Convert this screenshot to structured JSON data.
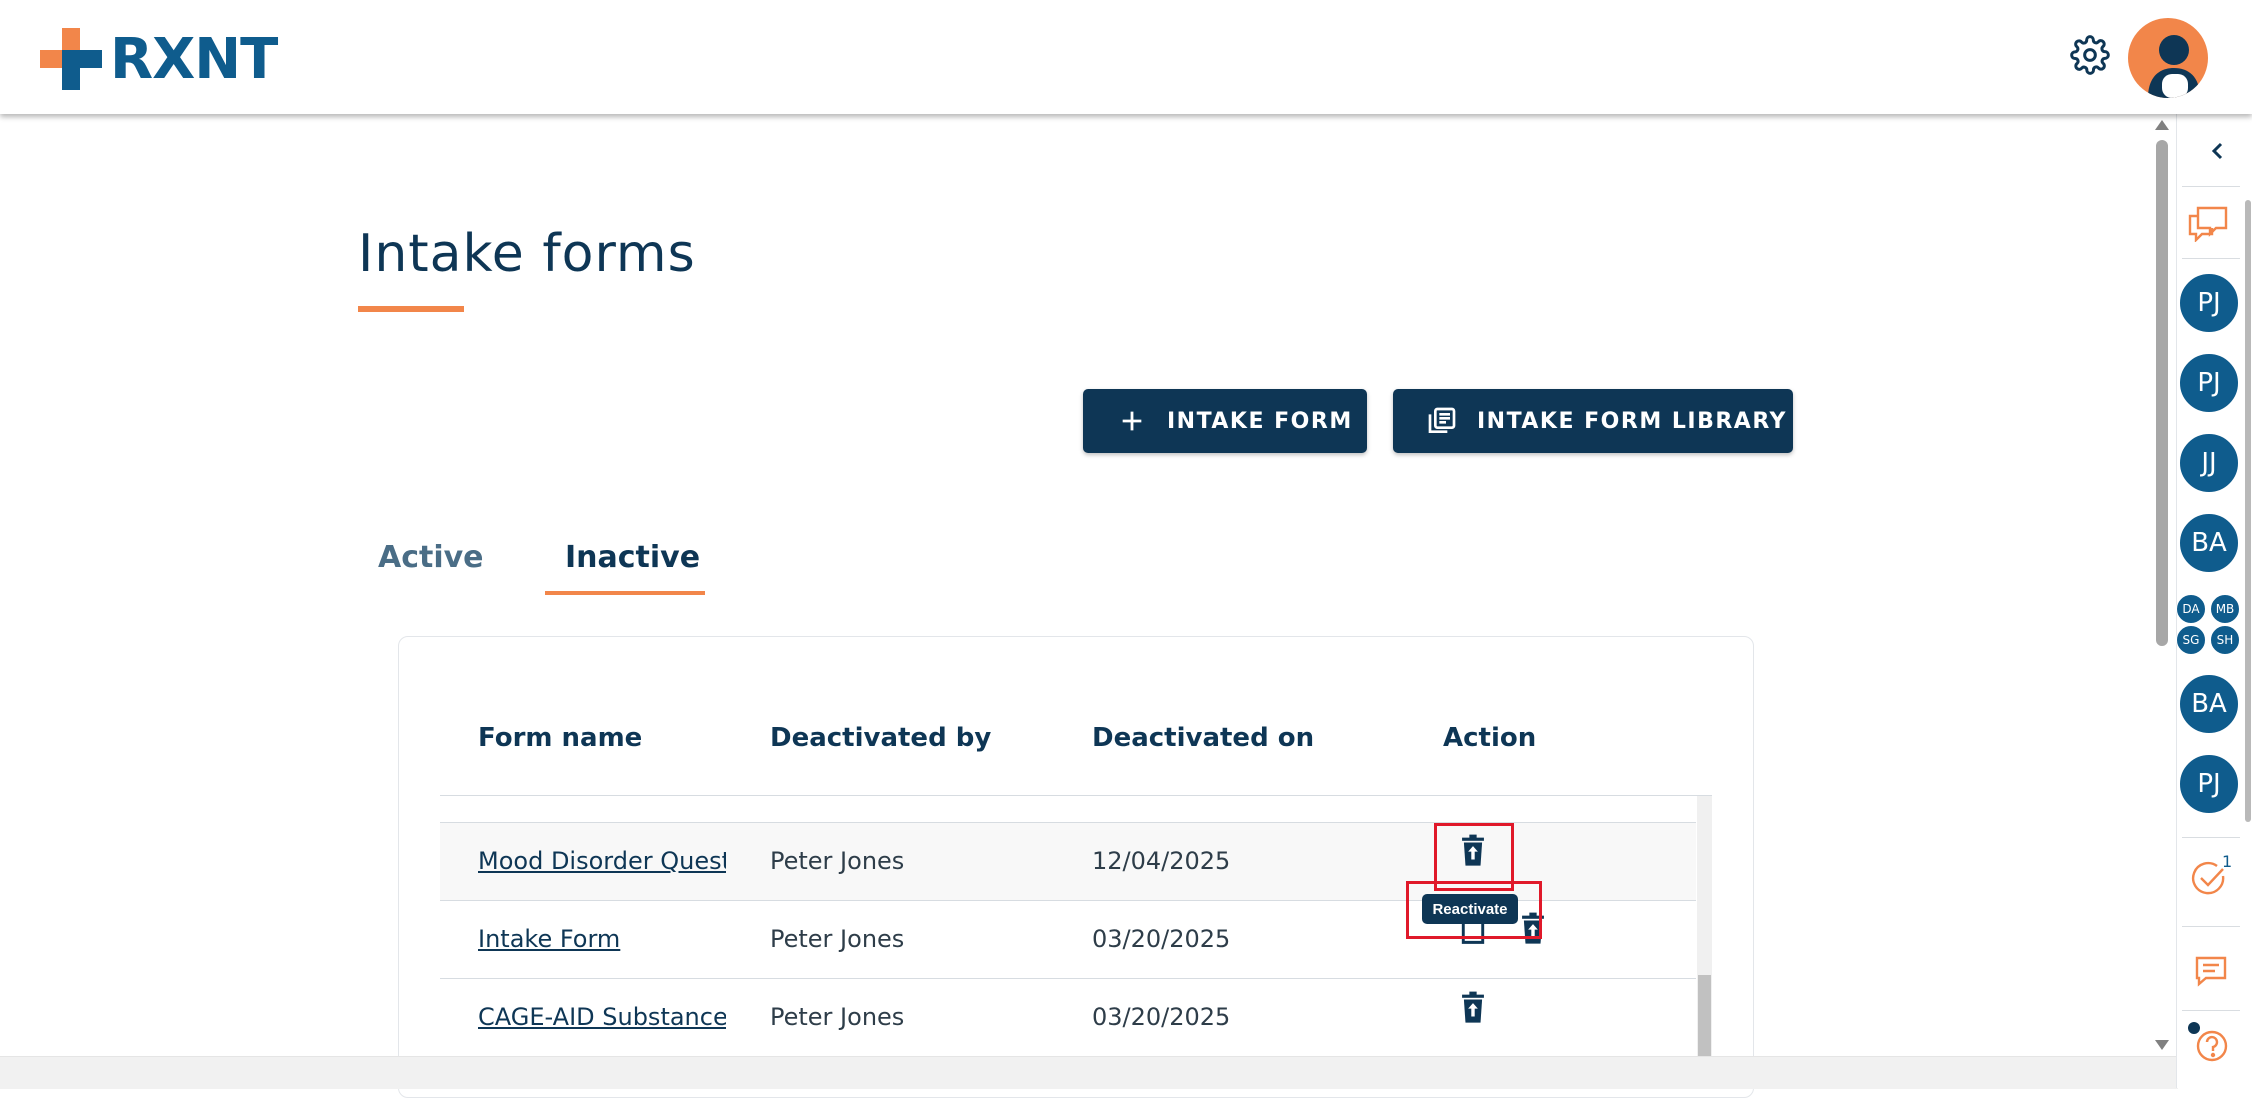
{
  "header": {
    "logo_text": "RXNT",
    "brand_colors": {
      "orange": "#f2864a",
      "blue": "#0f5c8d",
      "navy": "#0e3655"
    },
    "settings_icon": "gear-icon",
    "user_icon": "user-avatar-icon"
  },
  "main": {
    "title": "Intake forms",
    "buttons": {
      "add_intake_form": "INTAKE FORM",
      "intake_form_library": "INTAKE FORM LIBRARY"
    },
    "tabs": [
      {
        "label": "Active",
        "selected": false
      },
      {
        "label": "Inactive",
        "selected": true
      }
    ],
    "table": {
      "headers": [
        "Form name",
        "Deactivated by",
        "Deactivated on",
        "Action"
      ],
      "rows": [
        {
          "form_name": "Mood Disorder Questionnaire",
          "deactivated_by": "Peter Jones",
          "deactivated_on": "12/04/2025"
        },
        {
          "form_name": "Intake Form",
          "deactivated_by": "Peter Jones",
          "deactivated_on": "03/20/2025"
        },
        {
          "form_name": "CAGE-AID Substance Abuse",
          "deactivated_by": "Peter Jones",
          "deactivated_on": "03/20/2025"
        }
      ]
    },
    "tooltip": "Reactivate"
  },
  "rail": {
    "collapse_icon": "chevron-left-icon",
    "chat_icon": "chat-bubbles-icon",
    "avatars": [
      "PJ",
      "PJ",
      "JJ",
      "BA"
    ],
    "group_avatars": [
      "DA",
      "MB",
      "SG",
      "SH"
    ],
    "avatars_lower": [
      "BA",
      "PJ"
    ],
    "tasks_count": "1",
    "messages_icon": "message-icon",
    "help_icon": "help-icon"
  }
}
